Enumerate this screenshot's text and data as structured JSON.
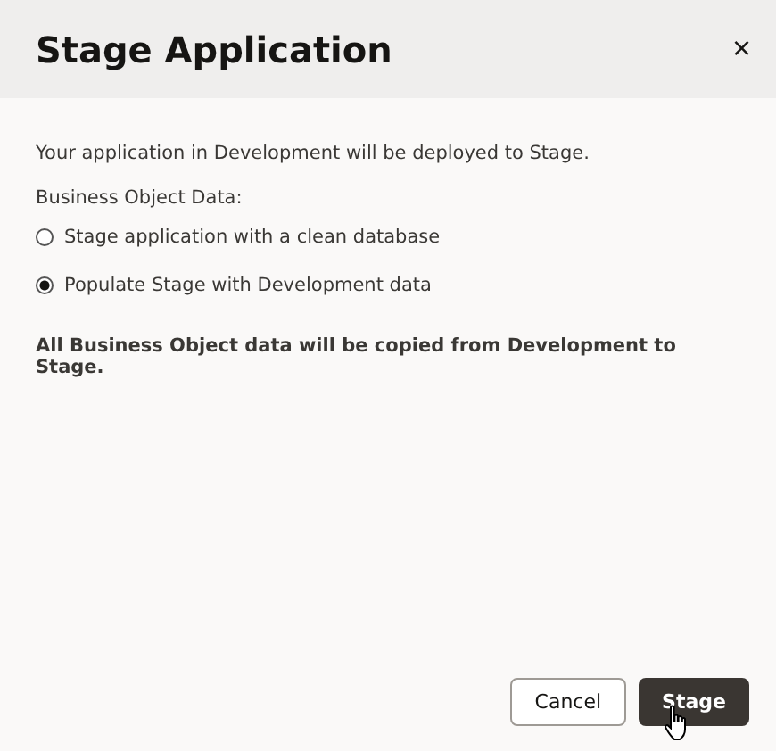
{
  "dialog": {
    "title": "Stage Application",
    "close": "×"
  },
  "message": "Your application in Development will be deployed to Stage.",
  "group": {
    "label": "Business Object Data:",
    "options": [
      {
        "label": "Stage application with a clean database",
        "selected": false
      },
      {
        "label": "Populate Stage with Development data",
        "selected": true
      }
    ]
  },
  "note": "All Business Object data will be copied from Development to Stage.",
  "buttons": [
    {
      "label": "Cancel",
      "kind": "secondary"
    },
    {
      "label": "Stage",
      "kind": "primary"
    }
  ]
}
